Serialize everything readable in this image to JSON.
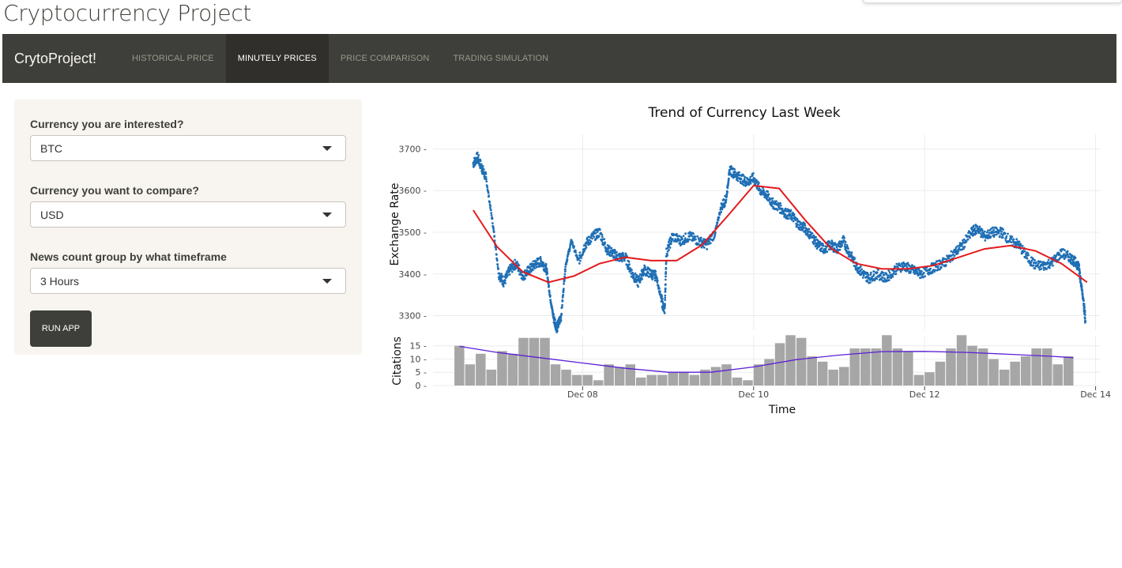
{
  "page": {
    "title": "Cryptocurrency Project"
  },
  "navbar": {
    "brand": "CrytoProject!",
    "tabs": [
      {
        "label": "HISTORICAL PRICE",
        "active": false
      },
      {
        "label": "MINUTELY PRICES",
        "active": true
      },
      {
        "label": "PRICE COMPARISON",
        "active": false
      },
      {
        "label": "TRADING SIMULATION",
        "active": false
      }
    ]
  },
  "sidebar": {
    "currency_label": "Currency you are interested?",
    "currency_value": "BTC",
    "compare_label": "Currency you want to compare?",
    "compare_value": "USD",
    "timeframe_label": "News count group by what timeframe",
    "timeframe_value": "3 Hours",
    "run_label": "RUN APP"
  },
  "colors": {
    "navbar_bg": "#3e3f3a",
    "nav_active_bg": "#302f2b",
    "sidebar_bg": "#f8f5f0",
    "scatter": "#1f6fb5",
    "smooth_price": "#e41a1c",
    "bars": "#a6a6a6",
    "smooth_citations": "#5b1fd6"
  },
  "chart_data": [
    {
      "type": "scatter",
      "title": "Trend of Currency Last Week",
      "xlabel": "",
      "ylabel": "Exchange Rate",
      "ylim": [
        3265,
        3735
      ],
      "xlim": [
        6.25,
        14.05
      ],
      "y_ticks": [
        3300,
        3400,
        3500,
        3600,
        3700
      ],
      "grid": true,
      "series": [
        {
          "x": [
            6.72,
            6.77,
            6.82,
            6.87,
            6.95,
            7.02,
            7.08,
            7.15,
            7.22,
            7.3,
            7.38,
            7.45,
            7.52,
            7.58,
            7.62,
            7.66,
            7.7,
            7.75,
            7.8,
            7.87,
            7.95,
            8.03,
            8.12,
            8.2,
            8.28,
            8.35,
            8.42,
            8.5,
            8.58,
            8.65,
            8.72,
            8.8,
            8.86,
            8.92,
            8.96,
            8.98,
            9.05,
            9.15,
            9.25,
            9.35,
            9.45,
            9.55,
            9.62,
            9.68,
            9.72,
            9.78,
            9.85,
            9.92,
            10.0,
            10.08,
            10.15,
            10.22,
            10.3,
            10.38,
            10.45,
            10.52,
            10.6,
            10.68,
            10.75,
            10.82,
            10.9,
            10.98,
            11.05,
            11.12,
            11.2,
            11.28,
            11.35,
            11.45,
            11.55,
            11.65,
            11.75,
            11.85,
            11.95,
            12.05,
            12.15,
            12.25,
            12.35,
            12.45,
            12.55,
            12.62,
            12.7,
            12.8,
            12.9,
            13.0,
            13.1,
            13.2,
            13.3,
            13.4,
            13.5,
            13.6,
            13.7,
            13.75,
            13.8,
            13.83,
            13.86,
            13.88
          ],
          "y": [
            3665,
            3680,
            3655,
            3630,
            3520,
            3400,
            3380,
            3410,
            3425,
            3395,
            3410,
            3425,
            3430,
            3410,
            3345,
            3295,
            3270,
            3300,
            3420,
            3480,
            3430,
            3470,
            3490,
            3500,
            3460,
            3450,
            3440,
            3440,
            3400,
            3380,
            3410,
            3400,
            3395,
            3340,
            3310,
            3450,
            3490,
            3480,
            3490,
            3480,
            3470,
            3500,
            3560,
            3580,
            3650,
            3640,
            3630,
            3620,
            3630,
            3600,
            3590,
            3570,
            3560,
            3545,
            3540,
            3520,
            3510,
            3490,
            3470,
            3460,
            3470,
            3460,
            3480,
            3450,
            3420,
            3400,
            3390,
            3400,
            3390,
            3410,
            3420,
            3410,
            3400,
            3410,
            3420,
            3430,
            3450,
            3470,
            3500,
            3510,
            3490,
            3500,
            3500,
            3480,
            3470,
            3440,
            3420,
            3420,
            3430,
            3450,
            3440,
            3430,
            3420,
            3380,
            3330,
            3290
          ]
        },
        {
          "name": "",
          "x": [
            6.72,
            7.0,
            7.3,
            7.6,
            7.9,
            8.2,
            8.5,
            8.8,
            9.1,
            9.4,
            9.7,
            10.0,
            10.3,
            10.6,
            10.9,
            11.2,
            11.5,
            11.8,
            12.1,
            12.4,
            12.7,
            13.0,
            13.3,
            13.6,
            13.9
          ],
          "y": [
            3553,
            3465,
            3405,
            3380,
            3395,
            3425,
            3440,
            3432,
            3432,
            3470,
            3540,
            3612,
            3605,
            3530,
            3462,
            3425,
            3412,
            3412,
            3420,
            3440,
            3460,
            3468,
            3455,
            3425,
            3380
          ]
        }
      ]
    },
    {
      "type": "bar",
      "xlabel": "Time",
      "ylabel": "Citations",
      "ylim": [
        0,
        18.5
      ],
      "y_ticks": [
        0,
        5,
        10,
        15
      ],
      "x_ticks": [
        "Dec 08",
        "Dec 10",
        "Dec 12",
        "Dec 14"
      ],
      "x_tick_days": [
        8,
        10,
        12,
        14
      ],
      "bar_width_days": 0.125,
      "bar_start_day": 6.5,
      "values": [
        15,
        8,
        12,
        6,
        13,
        12,
        18,
        18,
        18,
        8,
        6,
        4,
        4,
        2,
        8,
        7,
        8,
        3,
        4,
        4,
        5,
        5,
        4,
        6,
        7,
        8,
        3,
        2,
        8,
        10,
        16,
        19,
        18,
        11,
        9,
        6,
        7,
        14,
        14,
        14,
        19,
        14,
        13,
        4,
        5,
        9,
        14,
        19,
        15,
        14,
        10,
        6,
        9,
        11,
        14,
        14,
        8,
        11
      ],
      "smooth": {
        "x": [
          6.56,
          7.0,
          7.5,
          8.0,
          8.5,
          9.0,
          9.5,
          10.0,
          10.5,
          11.0,
          11.5,
          12.0,
          12.5,
          13.0,
          13.5,
          13.74
        ],
        "y": [
          14.8,
          12.5,
          10.5,
          8.5,
          6.5,
          5.0,
          5.0,
          7.0,
          9.8,
          11.5,
          12.8,
          12.9,
          12.5,
          11.8,
          11.0,
          10.5
        ]
      }
    }
  ]
}
